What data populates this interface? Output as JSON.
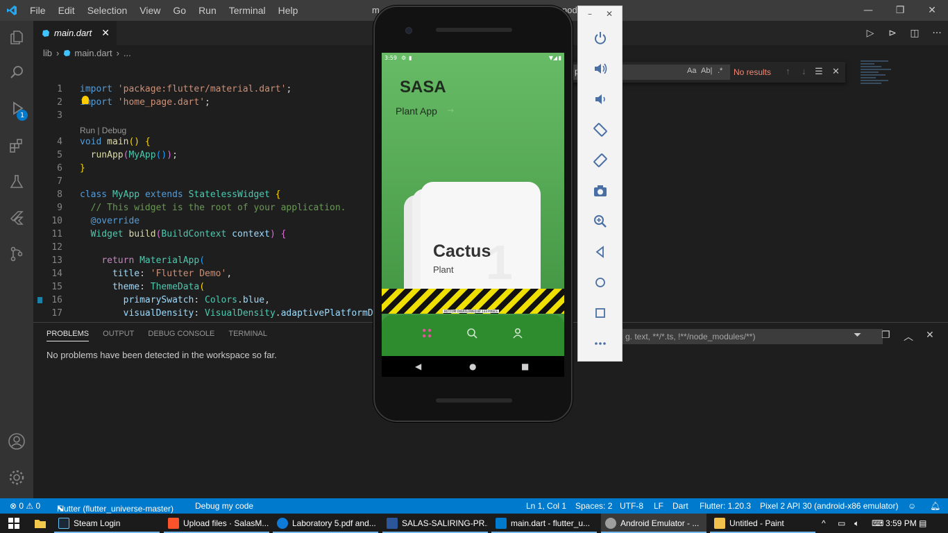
{
  "titlebar": {
    "menu": [
      "File",
      "Edit",
      "Selection",
      "View",
      "Go",
      "Run",
      "Terminal",
      "Help"
    ],
    "window_title": "m",
    "window_title_tail": "node"
  },
  "activity_bar": {
    "run_badge": "1"
  },
  "tab": {
    "label": "main.dart",
    "close": "✕"
  },
  "breadcrumb": {
    "folder": "lib",
    "file": "main.dart",
    "more": "..."
  },
  "code": {
    "codelens": "Run | Debug",
    "lines": [
      {
        "n": "1",
        "t": "import 'package:flutter/material.dart';"
      },
      {
        "n": "2",
        "t": "import 'home_page.dart';"
      },
      {
        "n": "3",
        "t": ""
      },
      {
        "n": "4",
        "t": "void main() {"
      },
      {
        "n": "5",
        "t": "  runApp(MyApp());"
      },
      {
        "n": "6",
        "t": "}"
      },
      {
        "n": "7",
        "t": ""
      },
      {
        "n": "8",
        "t": "class MyApp extends StatelessWidget {"
      },
      {
        "n": "9",
        "t": "  // This widget is the root of your application."
      },
      {
        "n": "10",
        "t": "  @override"
      },
      {
        "n": "11",
        "t": "  Widget build(BuildContext context) {"
      },
      {
        "n": "12",
        "t": ""
      },
      {
        "n": "13",
        "t": "    return MaterialApp("
      },
      {
        "n": "14",
        "t": "      title: 'Flutter Demo',"
      },
      {
        "n": "15",
        "t": "      theme: ThemeData("
      },
      {
        "n": "16",
        "t": "        primarySwatch: Colors.blue,"
      },
      {
        "n": "17",
        "t": "        visualDensity: VisualDensity.adaptivePlatformDe"
      }
    ]
  },
  "find_widget": {
    "partial_text": "p",
    "opt_case": "Aa",
    "opt_word": "Ab|",
    "opt_regex": ".*",
    "result": "No results"
  },
  "panel": {
    "tabs": [
      "PROBLEMS",
      "OUTPUT",
      "DEBUG CONSOLE",
      "TERMINAL"
    ],
    "message": "No problems have been detected in the workspace so far.",
    "filter_placeholder": "g. text, **/*.ts, !**/node_modules/**)"
  },
  "statusbar": {
    "errors": "⊗ 0 ⚠ 0",
    "flutter_project": "Flutter (flutter_universe-master)",
    "debug": "Debug my code",
    "position": "Ln 1, Col 1",
    "spaces": "Spaces: 2",
    "encoding": "UTF-8",
    "eol": "LF",
    "language": "Dart",
    "flutter_version": "Flutter: 1.20.3",
    "device": "Pixel 2 API 30 (android-x86 emulator)"
  },
  "taskbar": {
    "items": [
      {
        "label": "Steam Login",
        "color": "#1b2838"
      },
      {
        "label": "Upload files · SalasM...",
        "color": "#fb542b"
      },
      {
        "label": "Laboratory 5.pdf and...",
        "color": "#0f7bd8"
      },
      {
        "label": "SALAS-SALIRING-PR...",
        "color": "#2b579a"
      },
      {
        "label": "main.dart - flutter_u...",
        "color": "#007acc"
      },
      {
        "label": "Android Emulator - ...",
        "color": "#9e9e9e"
      },
      {
        "label": "Untitled - Paint",
        "color": "#f2c14e"
      }
    ],
    "time": "3:59 PM"
  },
  "emulator": {
    "status_time": "3:59",
    "app_title": "SASA",
    "app_subtitle": "Plant App",
    "card_title": "Cactus",
    "card_subtitle": "Plant",
    "card_number": "1",
    "overflow_label": "BOTTOM OVERFLOWED BY 133 PIXELS",
    "accent": "#e0569e"
  }
}
